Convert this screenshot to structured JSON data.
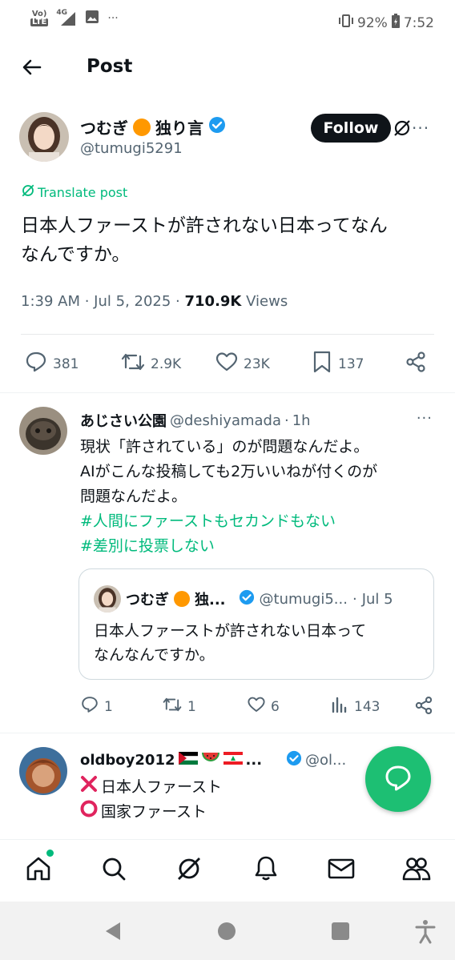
{
  "status_bar": {
    "network_top": "Vo)",
    "network_bottom": "LTE",
    "signal_label": "4G",
    "more": "···",
    "battery": "92%",
    "time": "7:52"
  },
  "header": {
    "title": "Post"
  },
  "post": {
    "author_name_a": "つむぎ",
    "author_name_b": "独り言",
    "author_handle": "@tumugi5291",
    "follow_label": "Follow",
    "translate_label": "Translate post",
    "text_line1": "日本人ファーストが許されない日本ってなん",
    "text_line2": "なんですか。",
    "time": "1:39 AM",
    "date": "Jul 5, 2025",
    "views_count": "710.9K",
    "views_label": "Views",
    "replies": "381",
    "reposts": "2.9K",
    "likes": "23K",
    "bookmarks": "137"
  },
  "reply1": {
    "name": "あじさい公園",
    "handle": "@deshiyamada",
    "time": "1h",
    "line1": "現状「許されている」のが問題なんだよ。",
    "line2": "AIがこんな投稿しても2万いいねが付くのが",
    "line3": "問題なんだよ。",
    "hashtag1": "#人間にファーストもセカンドもない",
    "hashtag2": "#差別に投票しない",
    "quote": {
      "name": "つむぎ",
      "name_rest": "独...",
      "handle": "@tumugi5...",
      "date": "Jul 5",
      "line1": "日本人ファーストが許されない日本って",
      "line2": "なんなんですか。"
    },
    "replies": "1",
    "reposts": "1",
    "likes": "6",
    "views": "143"
  },
  "reply2": {
    "name": "oldboy2012",
    "name_rest": "...",
    "handle": "@ol...",
    "line1": "日本人ファースト",
    "line2": "国家ファースト"
  },
  "colors": {
    "accent_green": "#00ba7c",
    "verified_blue": "#1d9bf0",
    "text_primary": "#0f1419",
    "text_secondary": "#536471"
  }
}
